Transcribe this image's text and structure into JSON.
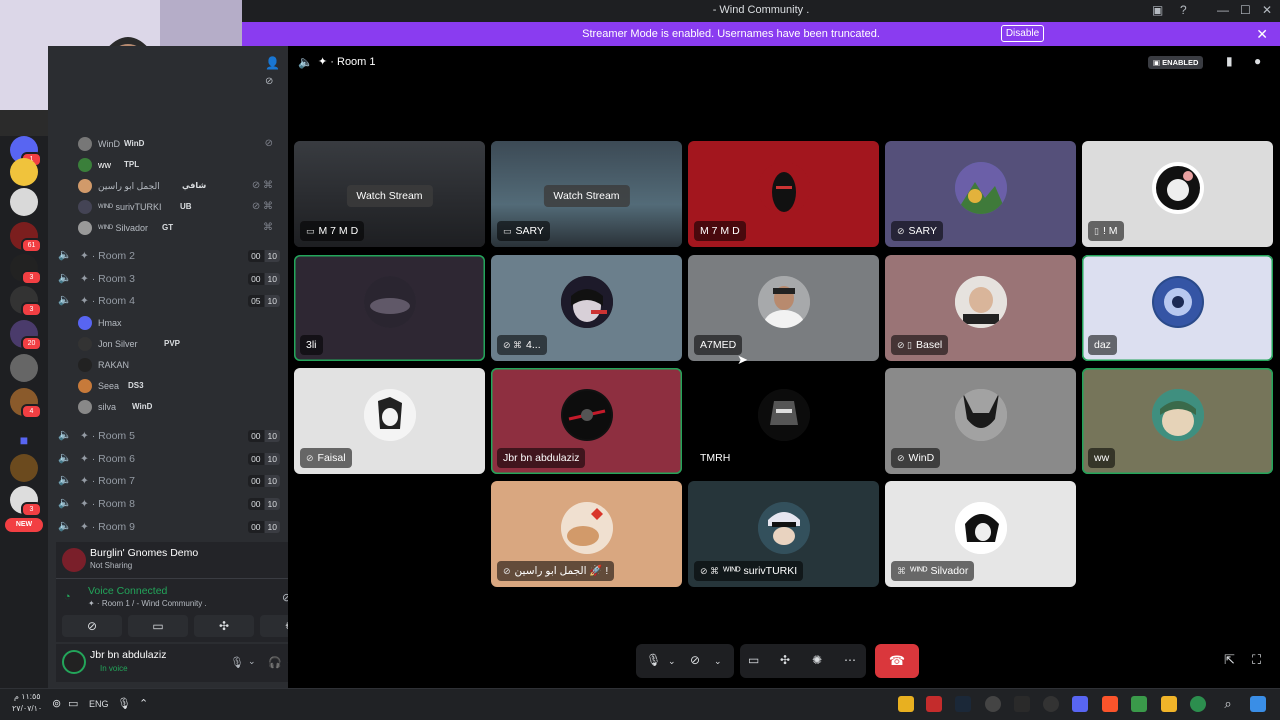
{
  "window": {
    "title": "- Wind Community ."
  },
  "banner": {
    "message": "Streamer Mode is enabled. Usernames have been truncated.",
    "disable_label": "Disable"
  },
  "header": {
    "room_name": "Room 1",
    "enabled_badge": "ENABLED"
  },
  "server_badges": [
    "1",
    "61",
    "3",
    "3",
    "20",
    "4",
    "3",
    "3"
  ],
  "server_new_label": "NEW",
  "voice_users_room1": [
    {
      "name": "WinD",
      "tag": "WinD"
    },
    {
      "name": "ww",
      "tag": "TPL"
    },
    {
      "name": "الجمل ابو راسين",
      "tag": "شافي"
    },
    {
      "name": "ᵂᴵᴺᴰ surivTURKI",
      "tag": "UB"
    },
    {
      "name": "ᵂᴵᴺᴰ Silvador",
      "tag": "GT"
    }
  ],
  "rooms_a": [
    {
      "name": "Room 2",
      "count": "00",
      "limit": "10"
    },
    {
      "name": "Room 3",
      "count": "00",
      "limit": "10"
    },
    {
      "name": "Room 4",
      "count": "05",
      "limit": "10"
    }
  ],
  "voice_users_room4": [
    {
      "name": "Hmax",
      "tag": ""
    },
    {
      "name": "Jon Silver",
      "tag": "PVP"
    },
    {
      "name": "RAKAN",
      "tag": ""
    },
    {
      "name": "Seea",
      "tag": "DS3"
    },
    {
      "name": "silva",
      "tag": "WinD"
    }
  ],
  "rooms_b": [
    {
      "name": "Room 5",
      "count": "00",
      "limit": "10"
    },
    {
      "name": "Room 6",
      "count": "00",
      "limit": "10"
    },
    {
      "name": "Room 7",
      "count": "00",
      "limit": "10"
    },
    {
      "name": "Room 8",
      "count": "00",
      "limit": "10"
    },
    {
      "name": "Room 9",
      "count": "00",
      "limit": "10"
    }
  ],
  "activity": {
    "game": "Burglin' Gnomes Demo",
    "status": "Not Sharing"
  },
  "voice": {
    "status": "Voice Connected",
    "location": "✦ · Room 1 / - Wind Community ."
  },
  "user": {
    "name": "Jbr bn abdulaziz",
    "status": "In voice"
  },
  "tiles": [
    {
      "label": "M 7 M D",
      "watch": "Watch Stream",
      "icon": "▭"
    },
    {
      "label": "SARY",
      "watch": "Watch Stream",
      "icon": "▭"
    },
    {
      "label": "M 7 M D",
      "watch": "",
      "icon": ""
    },
    {
      "label": "SARY",
      "watch": "",
      "icon": "⊘"
    },
    {
      "label": "! M",
      "watch": "",
      "icon": "▯"
    },
    {
      "label": "3li",
      "watch": "",
      "icon": ""
    },
    {
      "label": "4...",
      "watch": "",
      "icon": "⊘ ⌘"
    },
    {
      "label": "A7MED",
      "watch": "",
      "icon": ""
    },
    {
      "label": "Basel",
      "watch": "",
      "icon": "⊘ ▯"
    },
    {
      "label": "daz",
      "watch": "",
      "icon": ""
    },
    {
      "label": "Faisal",
      "watch": "",
      "icon": "⊘"
    },
    {
      "label": "Jbr bn abdulaziz",
      "watch": "",
      "icon": ""
    },
    {
      "label": "TMRH",
      "watch": "",
      "icon": ""
    },
    {
      "label": "WinD",
      "watch": "",
      "icon": "⊘"
    },
    {
      "label": "ww",
      "watch": "",
      "icon": ""
    },
    {
      "label": "الجمل ابو راسين 🚀 !",
      "watch": "",
      "icon": "⊘"
    },
    {
      "label": "ᵂᴵᴺᴰ surivTURKI",
      "watch": "",
      "icon": "⊘ ⌘"
    },
    {
      "label": "ᵂᴵᴺᴰ Silvador",
      "watch": "",
      "icon": "⌘"
    }
  ],
  "taskbar": {
    "time": "١١:٥٥ م",
    "date": "٢٧/٠٧/١٠",
    "lang": "ENG"
  },
  "colors": {
    "banner": "#8a3cf0",
    "speaking": "#23a55a",
    "leave": "#da373c",
    "sidebar": "#2b2d31"
  }
}
